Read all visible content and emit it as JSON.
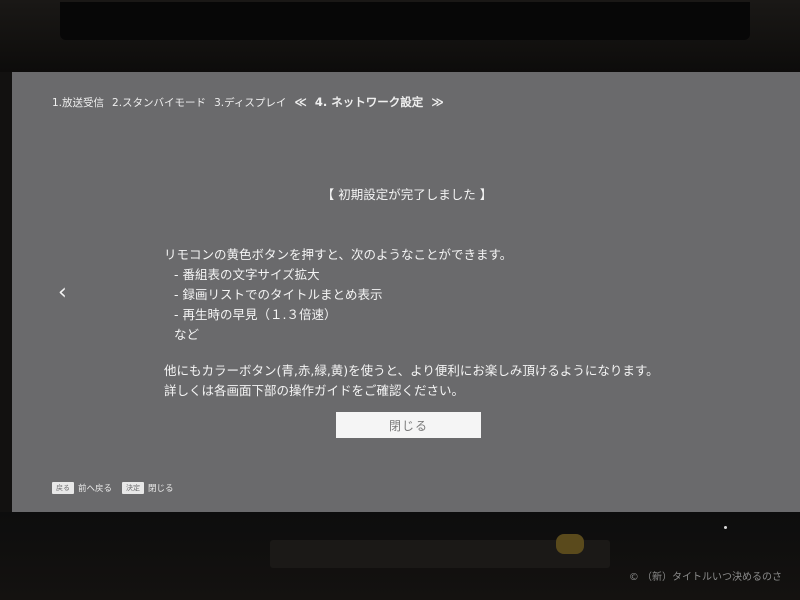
{
  "breadcrumb": {
    "items": [
      "1.放送受信",
      "2.スタンバイモード",
      "3.ディスプレイ"
    ],
    "active_left_marker": "≪",
    "active": "4. ネットワーク設定",
    "active_right_marker": "≫"
  },
  "dialog": {
    "title": "【 初期設定が完了しました 】",
    "intro": "リモコンの黄色ボタンを押すと、次のようなことができます。",
    "features": [
      "- 番組表の文字サイズ拡大",
      "- 録画リストでのタイトルまとめ表示",
      "- 再生時の早見（１.３倍速）"
    ],
    "etc": "など",
    "note_line1": "他にもカラーボタン(青,赤,緑,黄)を使うと、より便利にお楽しみ頂けるようになります。",
    "note_line2": "詳しくは各画面下部の操作ガイドをご確認ください。",
    "close_label": "閉じる"
  },
  "nav": {
    "left_arrow": "‹"
  },
  "help_bar": {
    "back_key": "戻る",
    "back_label": "前へ戻る",
    "ok_key": "決定",
    "ok_label": "閉じる"
  },
  "watermark": "© （新）タイトルいつ決めるのさ"
}
